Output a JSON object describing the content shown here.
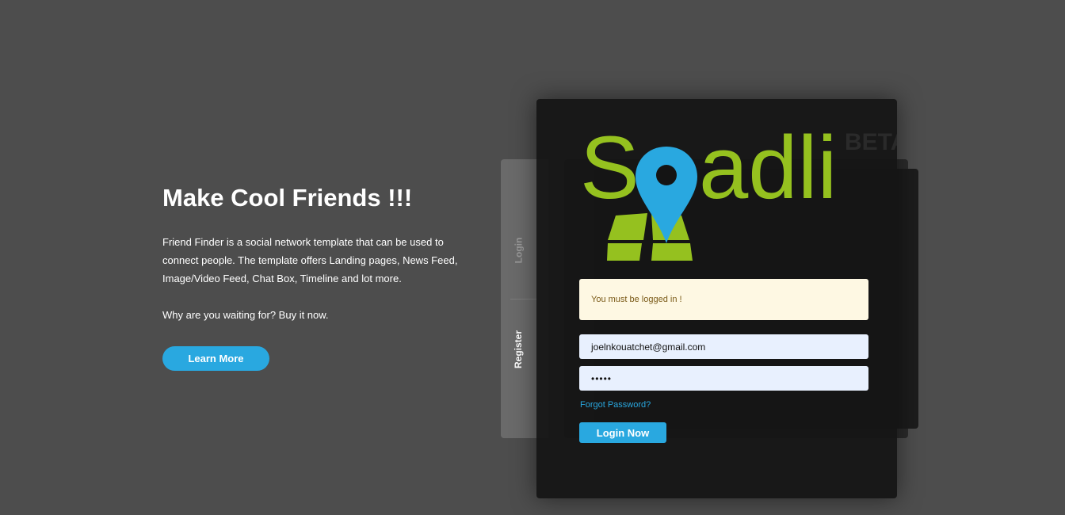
{
  "hero": {
    "title": "Make Cool Friends !!!",
    "description": "Friend Finder is a social network template that can be used to connect people. The template offers Landing pages, News Feed, Image/Video Feed, Chat Box, Timeline and lot more.",
    "cta_text": "Why are you waiting for? Buy it now.",
    "learn_more_label": "Learn More"
  },
  "tabs": {
    "login_label": "Login",
    "register_label": "Register"
  },
  "logo": {
    "text": "Spadli",
    "badge": "BETA",
    "green": "#95c11f",
    "blue": "#29a8e0"
  },
  "login_form": {
    "alert_message": "You must be logged in !",
    "email_value": "joelnkouatchet@gmail.com",
    "password_value": "•••••",
    "forgot_password_label": "Forgot Password?",
    "submit_label": "Login Now"
  },
  "colors": {
    "background": "#4d4d4d",
    "accent": "#29a8e0",
    "alert_bg": "#fef8e3"
  }
}
